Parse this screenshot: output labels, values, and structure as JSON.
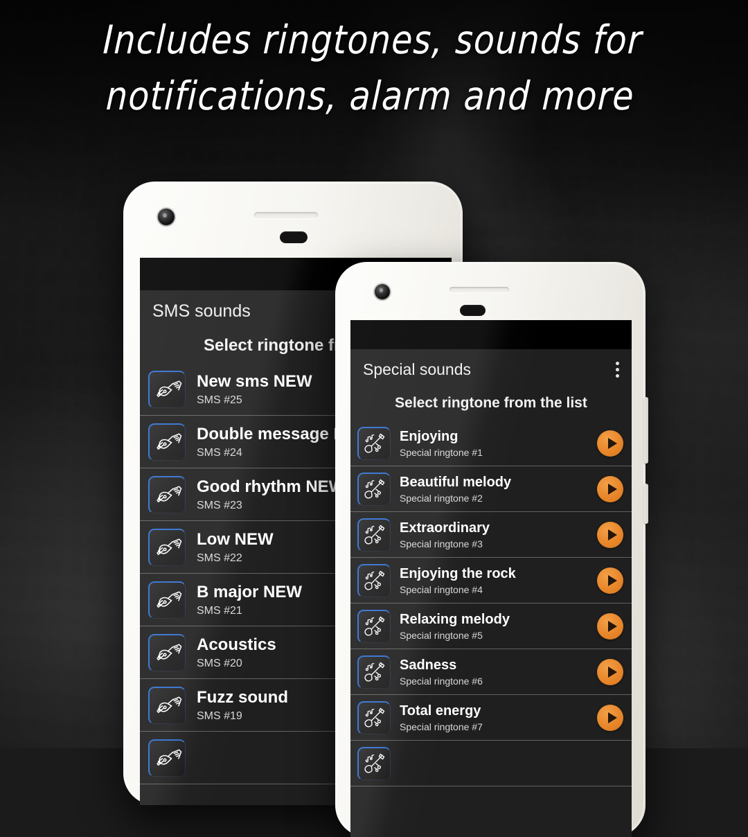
{
  "headline": "Includes ringtones, sounds for\nnotifications, alarm and more",
  "colors": {
    "accent_orange": "#e8862a",
    "icon_border_blue": "#2f6fd0",
    "screen_bg": "#1f1f1f",
    "text_primary": "#ffffff",
    "text_secondary": "#d8d8d8",
    "phone_body": "#f6f5f1",
    "statusbar": "#000000"
  },
  "left_phone": {
    "app_bar": {
      "title": "SMS sounds"
    },
    "subtitle": "Select ringtone from",
    "icons": {
      "row_thumb": "electric-guitar-icon"
    },
    "items": [
      {
        "title": "New sms NEW",
        "subtitle": "SMS #25"
      },
      {
        "title": "Double message NEW",
        "subtitle": "SMS #24"
      },
      {
        "title": "Good rhythm NEW",
        "subtitle": "SMS #23"
      },
      {
        "title": "Low NEW",
        "subtitle": "SMS #22"
      },
      {
        "title": "B major NEW",
        "subtitle": "SMS #21"
      },
      {
        "title": "Acoustics",
        "subtitle": "SMS #20"
      },
      {
        "title": "Fuzz sound",
        "subtitle": "SMS #19"
      },
      {
        "title": "",
        "subtitle": ""
      }
    ]
  },
  "right_phone": {
    "app_bar": {
      "title": "Special sounds",
      "overflow_icon": "more-vertical-icon"
    },
    "subtitle": "Select ringtone from the list",
    "icons": {
      "row_thumb": "guitar-with-notes-icon",
      "play": "play-icon"
    },
    "items": [
      {
        "title": "Enjoying",
        "subtitle": "Special ringtone #1"
      },
      {
        "title": "Beautiful melody",
        "subtitle": "Special ringtone #2"
      },
      {
        "title": "Extraordinary",
        "subtitle": "Special ringtone #3"
      },
      {
        "title": "Enjoying the rock",
        "subtitle": "Special ringtone #4"
      },
      {
        "title": "Relaxing melody",
        "subtitle": "Special ringtone #5"
      },
      {
        "title": "Sadness",
        "subtitle": "Special ringtone #6"
      },
      {
        "title": "Total energy",
        "subtitle": "Special ringtone #7"
      },
      {
        "title": "",
        "subtitle": ""
      }
    ]
  }
}
